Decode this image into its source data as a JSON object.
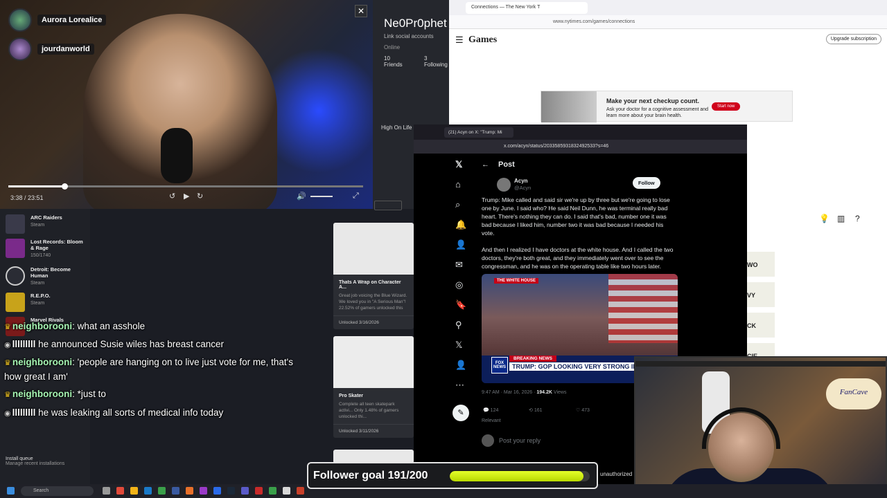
{
  "video": {
    "users": [
      {
        "name": "Aurora Lorealice"
      },
      {
        "name": "jourdanworld"
      }
    ],
    "time": "3:38 / 23:51",
    "progress": 0.159,
    "close_glyph": "✕",
    "controls": {
      "back": "↺",
      "play": "▶",
      "forward": "↻",
      "volume": "🔊",
      "fullscreen": "⤢"
    }
  },
  "profile": {
    "username": "Ne0Pr0phet",
    "link_social": "Link social accounts",
    "status": "Online",
    "friends_count": "10",
    "friends_label": "Friends",
    "following_count": "3",
    "following_label": "Following",
    "activity": "High On Life"
  },
  "games": {
    "items": [
      {
        "title": "ARC Raiders",
        "sub": "Steam",
        "color": "#3a3a4a"
      },
      {
        "title": "Lost Records: Bloom & Rage",
        "sub": "150/1740",
        "color": "#7a2a8a"
      },
      {
        "title": "Detroit: Become Human",
        "sub": "Steam",
        "color": "#2a2c34"
      },
      {
        "title": "R.E.P.O.",
        "sub": "Steam",
        "color": "#c8a31a"
      },
      {
        "title": "Marvel Rivals",
        "sub": "",
        "color": "#7a1a1a"
      }
    ],
    "install_title": "Install queue",
    "install_sub": "Manage recent installations"
  },
  "cards": [
    {
      "title": "Thats A Wrap on Character A...",
      "desc": "Great job voicing the Blue Wizard. We loved you in \"A Serious Man\"! 22.52% of gamers unlocked this",
      "unlocked": "Unlocked 3/16/2026"
    },
    {
      "title": "Pro Skater",
      "desc": "Complete all teen skatepark activi... Only 1.48% of gamers unlocked thi...",
      "unlocked": "Unlocked 3/11/2026"
    }
  ],
  "chat": [
    {
      "user": "neighborooni",
      "msg": ": what an asshole",
      "green": true
    },
    {
      "user": "lllllllll",
      "msg": " he announced Susie wiles has breast cancer",
      "green": false
    },
    {
      "user": "neighborooni",
      "msg": ": 'people are hanging on to live just vote for me, that's how great I am'",
      "green": true
    },
    {
      "user": "neighborooni",
      "msg": ": *just to",
      "green": true
    },
    {
      "user": "lllllllll",
      "msg": " he was leaking all sorts of medical info today",
      "green": false
    }
  ],
  "nyt": {
    "tab_title": "Connections — The New York T",
    "url": "www.nytimes.com/games/connections",
    "logo": "Games",
    "upgrade": "Upgrade subscription",
    "ad_headline": "Make your next checkup count.",
    "ad_body": "Ask your doctor for a cognitive assessment and learn more about your brain health.",
    "ad_button": "Start now",
    "tiles": [
      "WO",
      "VY",
      "CK",
      "CIE"
    ]
  },
  "xpost": {
    "tab_title": "(21) Acyn on X: \"Trump: Mi",
    "url": "x.com/acyn/status/2033585931832492533?s=46",
    "header": "Post",
    "author_name": "Acyn",
    "author_handle": "@Acyn",
    "follow_label": "Follow",
    "text_1": "Trump: Mike called and said sir we're up by three but we're going to lose one by June. I said who? He said Neil Dunn, he was terminal really bad heart. There's nothing they can do. I said that's bad, number one it was bad because I liked him, number two it was bad because I needed his vote.",
    "text_2": "And then I realized I have doctors at the white house. And I called the two doctors, they're both great, and they immediately went over to see the congressman, and he was on the operating table like two hours later.",
    "image_banner": "THE WHITE HOUSE",
    "image_breaking": "BREAKING NEWS",
    "image_headline": "TRUMP: GOP LOOKING VERY STRONG IN HOUSE",
    "image_network": "FOX NEWS",
    "timestamp": "9:47 AM · Mar 16, 2026 · ",
    "views_count": "194.2K",
    "views_label": " Views",
    "replies": "124",
    "reposts": "161",
    "likes": "473",
    "relevant": "Relevant",
    "reply_placeholder": "Post your reply"
  },
  "cam": {
    "sign": "FanCave"
  },
  "taskbar": {
    "search": "Search"
  },
  "goal": {
    "label": "Follower goal 191/200",
    "current": 191,
    "target": 200
  },
  "unauthorized": "unauthorized"
}
